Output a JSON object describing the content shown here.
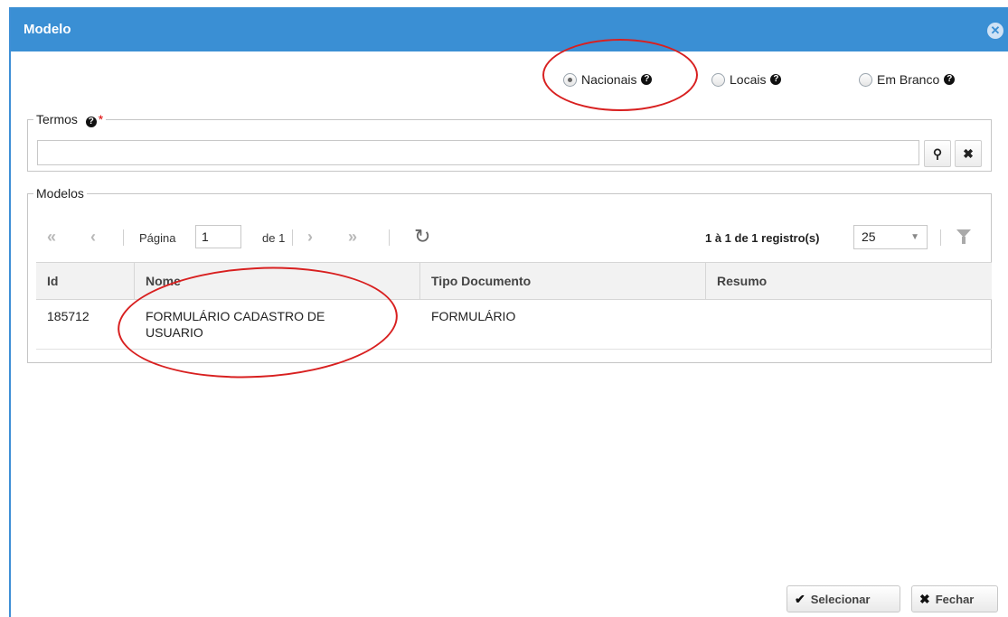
{
  "dialog": {
    "title": "Modelo"
  },
  "radios": [
    {
      "label": "Nacionais",
      "checked": true
    },
    {
      "label": "Locais",
      "checked": false
    },
    {
      "label": "Em Branco",
      "checked": false
    }
  ],
  "termos": {
    "legend": "Termos",
    "required_mark": "*",
    "value": ""
  },
  "modelos": {
    "legend": "Modelos",
    "pager": {
      "page_label": "Página",
      "page_value": "1",
      "of_label": "de 1",
      "records": "1 à 1 de 1 registro(s)",
      "page_size": "25"
    },
    "columns": [
      "Id",
      "Nome",
      "Tipo Documento",
      "Resumo"
    ],
    "rows": [
      {
        "id": "185712",
        "nome_line1": "FORMULÁRIO CADASTRO DE",
        "nome_line2": "USUARIO",
        "tipo": "FORMULÁRIO",
        "resumo": ""
      }
    ]
  },
  "footer": {
    "select_label": "Selecionar",
    "close_label": "Fechar"
  },
  "colors": {
    "titlebar": "#3a8fd4",
    "annotation": "#d82020"
  }
}
